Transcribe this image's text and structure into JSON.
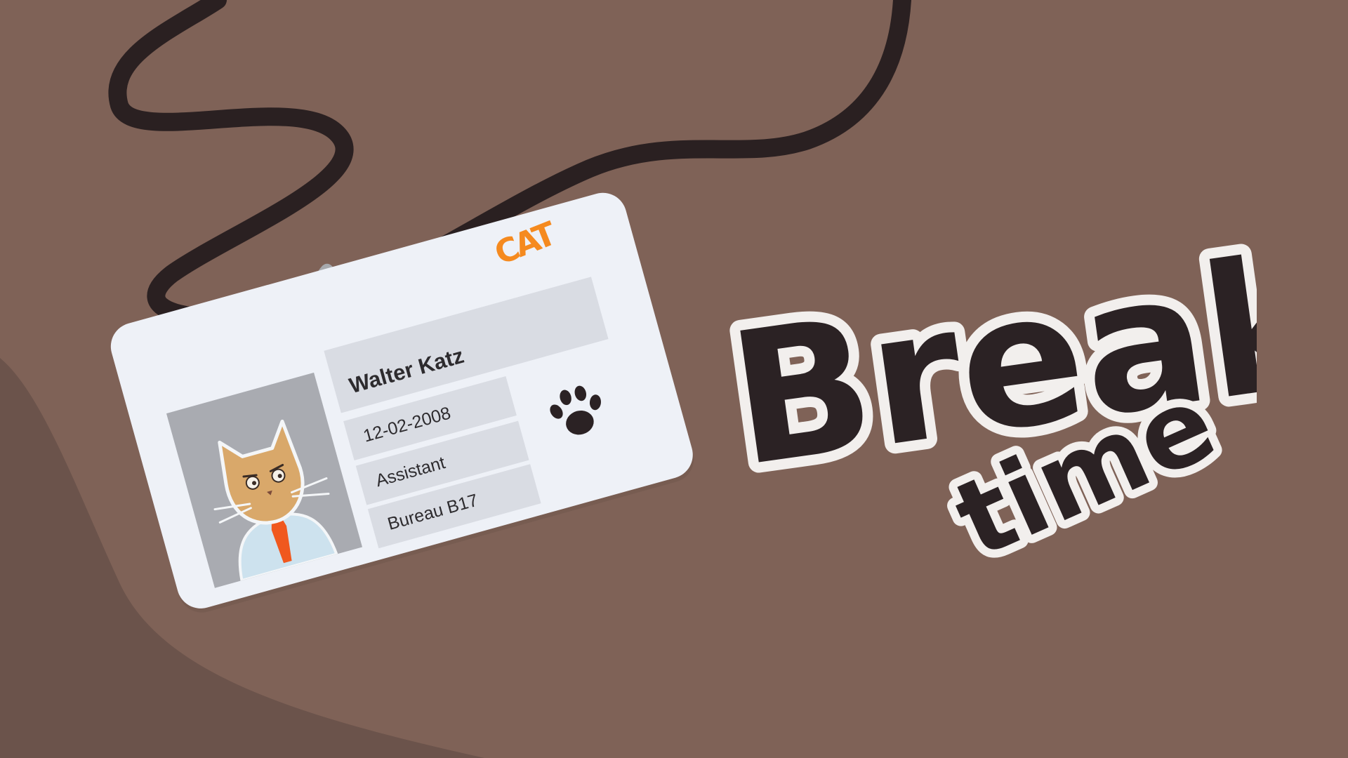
{
  "badge": {
    "logo_text": "CAT",
    "name": "Walter Katz",
    "date": "12-02-2008",
    "role": "Assistant",
    "location": "Bureau B17"
  },
  "sticker": {
    "line1": "Break",
    "line2": "time"
  },
  "colors": {
    "background": "#7f6257",
    "background_shadow": "#6b534b",
    "lanyard": "#2a2021",
    "card": "#eef1f7",
    "field": "#d9dce3",
    "logo_orange": "#f58a1f",
    "cat_fur": "#d9a86a",
    "tie": "#f0581e",
    "sticker_fill": "#2b2224",
    "sticker_outline": "#f2efed"
  },
  "icons": [
    "paw-icon",
    "cat-portrait",
    "lanyard-clip"
  ]
}
